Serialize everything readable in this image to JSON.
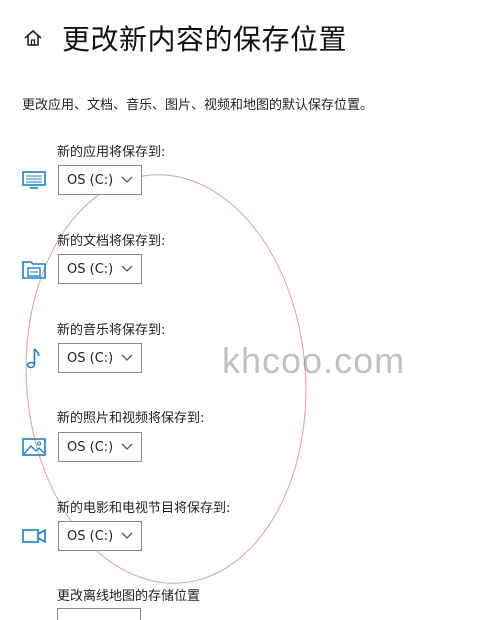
{
  "header": {
    "icon": "home-icon",
    "title": "更改新内容的保存位置"
  },
  "description": "更改应用、文档、音乐、图片、视频和地图的默认保存位置。",
  "groups": [
    {
      "label": "新的应用将保存到:",
      "icon": "monitor-icon",
      "value": "OS (C:)"
    },
    {
      "label": "新的文档将保存到:",
      "icon": "folder-icon",
      "value": "OS (C:)"
    },
    {
      "label": "新的音乐将保存到:",
      "icon": "music-note-icon",
      "value": "OS (C:)"
    },
    {
      "label": "新的照片和视频将保存到:",
      "icon": "picture-icon",
      "value": "OS (C:)"
    },
    {
      "label": "新的电影和电视节目将保存到:",
      "icon": "video-camera-icon",
      "value": "OS (C:)"
    }
  ],
  "offline_maps_label": "更改离线地图的存储位置",
  "watermark": "khcoo.com",
  "colors": {
    "icon_accent": "#1b7fc9",
    "annotation_circle": "#d7a0a0"
  }
}
